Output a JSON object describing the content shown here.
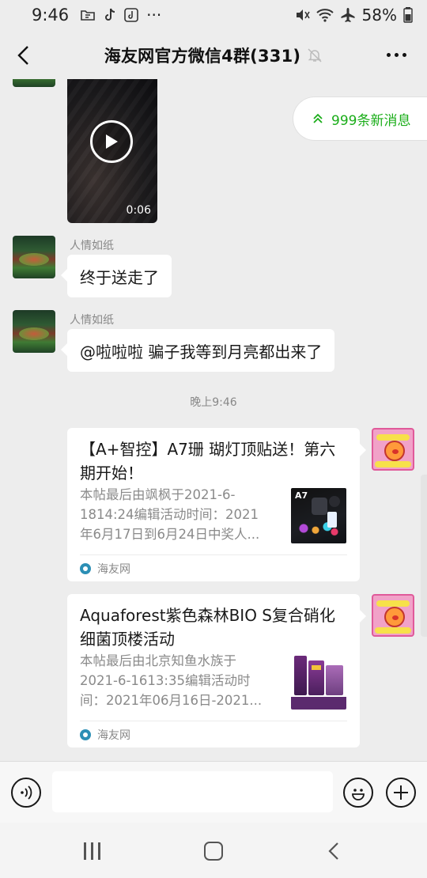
{
  "status_bar": {
    "time": "9:46",
    "left_icons": [
      "folder-icon",
      "tiktok-icon",
      "tiktok-square-icon",
      "more-dots-icon"
    ],
    "more_dots": "···",
    "right_icons": [
      "mute-icon",
      "wifi-icon",
      "airplane-icon",
      "battery-icon"
    ],
    "battery": "58%"
  },
  "header": {
    "title": "海友网官方微信4群(331)",
    "back_icon": "chevron-left-icon",
    "mute_icon": "bell-off-icon",
    "more_icon": "more-horizontal-icon"
  },
  "new_messages": {
    "label": "999条新消息",
    "icon": "double-chevron-up-icon",
    "color": "#1aad19"
  },
  "video_message": {
    "duration": "0:06",
    "icon": "play-icon"
  },
  "messages": [
    {
      "sender": "人情如纸",
      "text": "终于送走了"
    },
    {
      "sender": "人情如纸",
      "text": "@啦啦啦  骗子我等到月亮都出来了"
    }
  ],
  "time_separator": "晚上9:46",
  "cards": [
    {
      "title": "【A+智控】A7珊 瑚灯顶贴送！第六期开始！",
      "desc_lines": [
        "本帖最后由飒枫于2021-6-",
        "1814:24编辑活动时间：2021",
        "年6月17日到6月24日中奖人..."
      ],
      "thumb_label": "A7",
      "source": "海友网"
    },
    {
      "title": "Aquaforest紫色森林BIO S复合硝化细菌顶楼活动",
      "desc_lines": [
        "本帖最后由北京知鱼水族于",
        "2021-6-1613:35编辑活动时",
        "间：2021年06月16日-2021..."
      ],
      "source": "海友网"
    }
  ],
  "input_bar": {
    "placeholder": "",
    "voice_icon": "voice-icon",
    "emoji_icon": "emoji-icon",
    "plus_icon": "plus-circle-icon"
  },
  "nav_bar": {
    "recent_icon": "recent-apps-icon",
    "home_icon": "home-icon",
    "back_icon": "back-icon"
  }
}
